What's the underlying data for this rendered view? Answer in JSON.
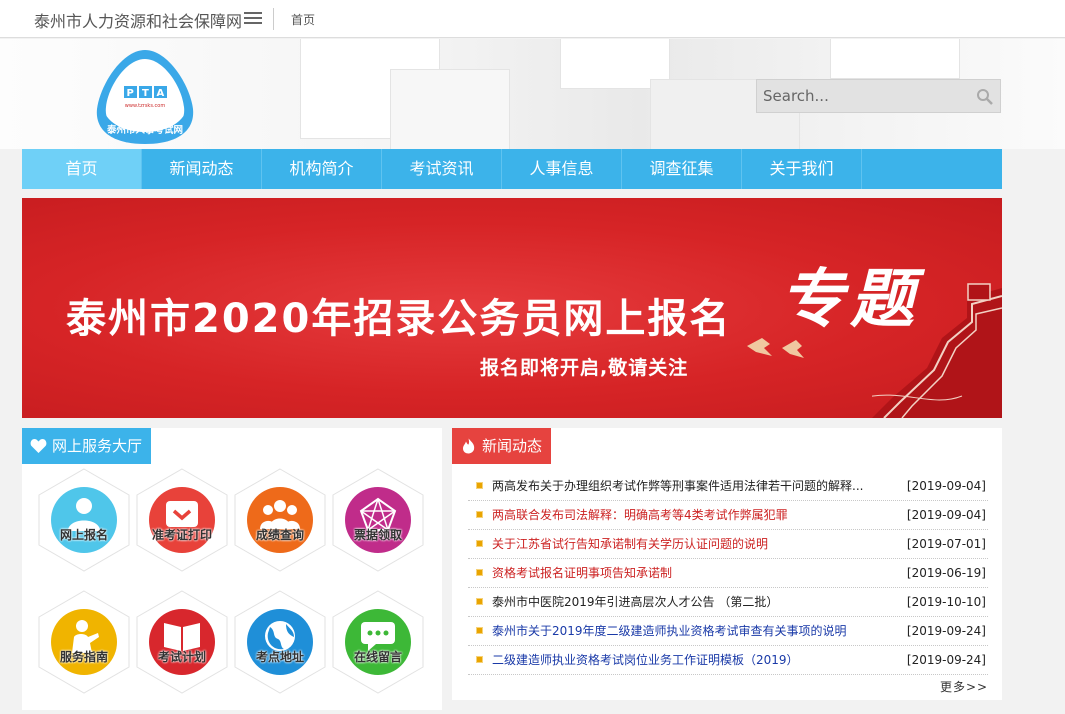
{
  "topbar": {
    "site_title": "泰州市人力资源和社会保障网",
    "home_link": "首页"
  },
  "logo": {
    "badge_text": "PTA",
    "url_text": "www.tzrsks.com",
    "name_text": "泰州市人事考试网"
  },
  "search": {
    "placeholder": "Search..."
  },
  "nav": {
    "items": [
      {
        "label": "首页"
      },
      {
        "label": "新闻动态"
      },
      {
        "label": "机构简介"
      },
      {
        "label": "考试资讯"
      },
      {
        "label": "人事信息"
      },
      {
        "label": "调查征集"
      },
      {
        "label": "关于我们"
      }
    ]
  },
  "banner": {
    "title": "泰州市2020年招录公务员网上报名",
    "special": "专题",
    "subtitle": "报名即将开启,敬请关注"
  },
  "services": {
    "title": "网上服务大厅",
    "items": [
      {
        "label": "网上报名",
        "color": "#4fc6ea"
      },
      {
        "label": "准考证打印",
        "color": "#e8423a"
      },
      {
        "label": "成绩查询",
        "color": "#ee6a1a"
      },
      {
        "label": "票据领取",
        "color": "#c02c8a"
      },
      {
        "label": "服务指南",
        "color": "#f0b400"
      },
      {
        "label": "考试计划",
        "color": "#d8272d"
      },
      {
        "label": "考点地址",
        "color": "#1f8fd8"
      },
      {
        "label": "在线留言",
        "color": "#3db837"
      }
    ]
  },
  "news": {
    "title": "新闻动态",
    "more": "更多>>",
    "items": [
      {
        "title": "两高发布关于办理组织考试作弊等刑事案件适用法律若干问题的解释...",
        "date": "[2019-09-04]",
        "color": "#222222"
      },
      {
        "title": "两高联合发布司法解释：明确高考等4类考试作弊属犯罪",
        "date": "[2019-09-04]",
        "color": "#cc2222"
      },
      {
        "title": "关于江苏省试行告知承诺制有关学历认证问题的说明",
        "date": "[2019-07-01]",
        "color": "#cc2222"
      },
      {
        "title": "资格考试报名证明事项告知承诺制",
        "date": "[2019-06-19]",
        "color": "#cc2222"
      },
      {
        "title": "泰州市中医院2019年引进高层次人才公告 （第二批）",
        "date": "[2019-10-10]",
        "color": "#222222"
      },
      {
        "title": "泰州市关于2019年度二级建造师执业资格考试审查有关事项的说明",
        "date": "[2019-09-24]",
        "color": "#1a3aa8"
      },
      {
        "title": "二级建造师执业资格考试岗位业务工作证明模板（2019）",
        "date": "[2019-09-24]",
        "color": "#1a3aa8"
      }
    ]
  }
}
